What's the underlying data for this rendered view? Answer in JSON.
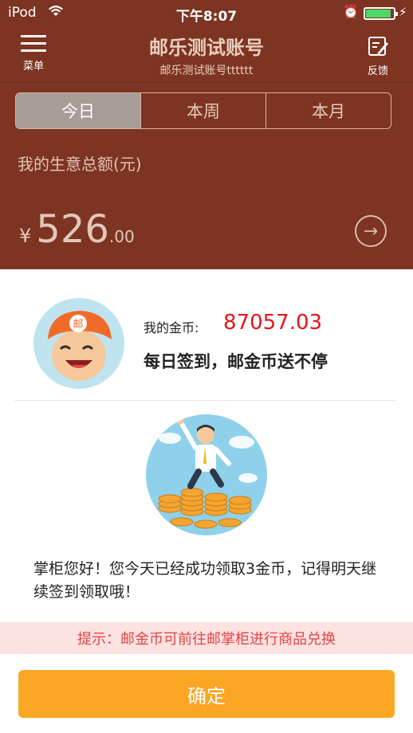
{
  "status_bar": {
    "carrier": "iPod",
    "time": "下午8:07",
    "battery_level": 0.9,
    "colors": {
      "battery": "#4cd964"
    }
  },
  "nav": {
    "menu_label": "菜单",
    "title": "邮乐测试账号",
    "subtitle": "邮乐测试账号tttttt",
    "feedback_label": "反馈",
    "icons": {
      "menu": "hamburger-icon",
      "feedback": "edit-note-icon"
    }
  },
  "segments": [
    {
      "label": "今日",
      "active": true
    },
    {
      "label": "本周",
      "active": false
    },
    {
      "label": "本月",
      "active": false
    }
  ],
  "summary": {
    "label": "我的生意总额(元)",
    "currency": "¥",
    "amount_int": "526",
    "amount_dec": ".00"
  },
  "coins": {
    "label": "我的金币:",
    "value": "87057.03",
    "slogan": "每日签到，邮金币送不停",
    "avatar_badge": "邮"
  },
  "message": "掌柜您好！您今天已经成功领取3金币，记得明天继续签到领取哦！",
  "tip": "提示：邮金币可前往邮掌柜进行商品兑换",
  "confirm_label": "确定",
  "colors": {
    "header_bg": "#7d3422",
    "coin_value": "#e8141b",
    "tip_text": "#e24545",
    "tip_bg": "#fde2e2",
    "confirm_bg": "#fca625"
  }
}
